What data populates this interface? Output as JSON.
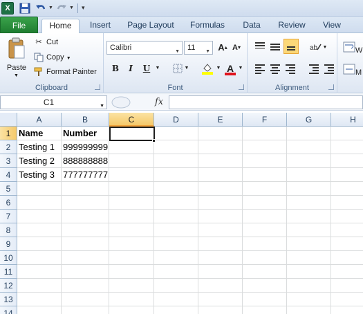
{
  "qat": {
    "app_icon": "X"
  },
  "tabs": [
    {
      "label": "File"
    },
    {
      "label": "Home"
    },
    {
      "label": "Insert"
    },
    {
      "label": "Page Layout"
    },
    {
      "label": "Formulas"
    },
    {
      "label": "Data"
    },
    {
      "label": "Review"
    },
    {
      "label": "View"
    }
  ],
  "ribbon": {
    "clipboard": {
      "paste": "Paste",
      "cut": "Cut",
      "copy": "Copy",
      "format_painter": "Format Painter",
      "label": "Clipboard"
    },
    "font": {
      "name": "Calibri",
      "size": "11",
      "label": "Font",
      "bold": "B",
      "italic": "I",
      "underline": "U",
      "font_color": "#e0141e",
      "fill_color": "#ffff00"
    },
    "alignment": {
      "label": "Alignment"
    }
  },
  "formula_bar": {
    "name_box": "C1",
    "fx": "fx",
    "formula": ""
  },
  "columns": [
    "A",
    "B",
    "C",
    "D",
    "E",
    "F",
    "G",
    "H"
  ],
  "rows": [
    "1",
    "2",
    "3",
    "4",
    "5",
    "6",
    "7",
    "8",
    "9",
    "10",
    "11",
    "12",
    "13",
    "14"
  ],
  "cells": {
    "A1": "Name",
    "B1": "Number",
    "A2": "Testing 1",
    "B2": "999999999",
    "A3": "Testing 2",
    "B3": "888888888",
    "A4": "Testing 3",
    "B4": "777777777"
  },
  "active_cell": "C1"
}
